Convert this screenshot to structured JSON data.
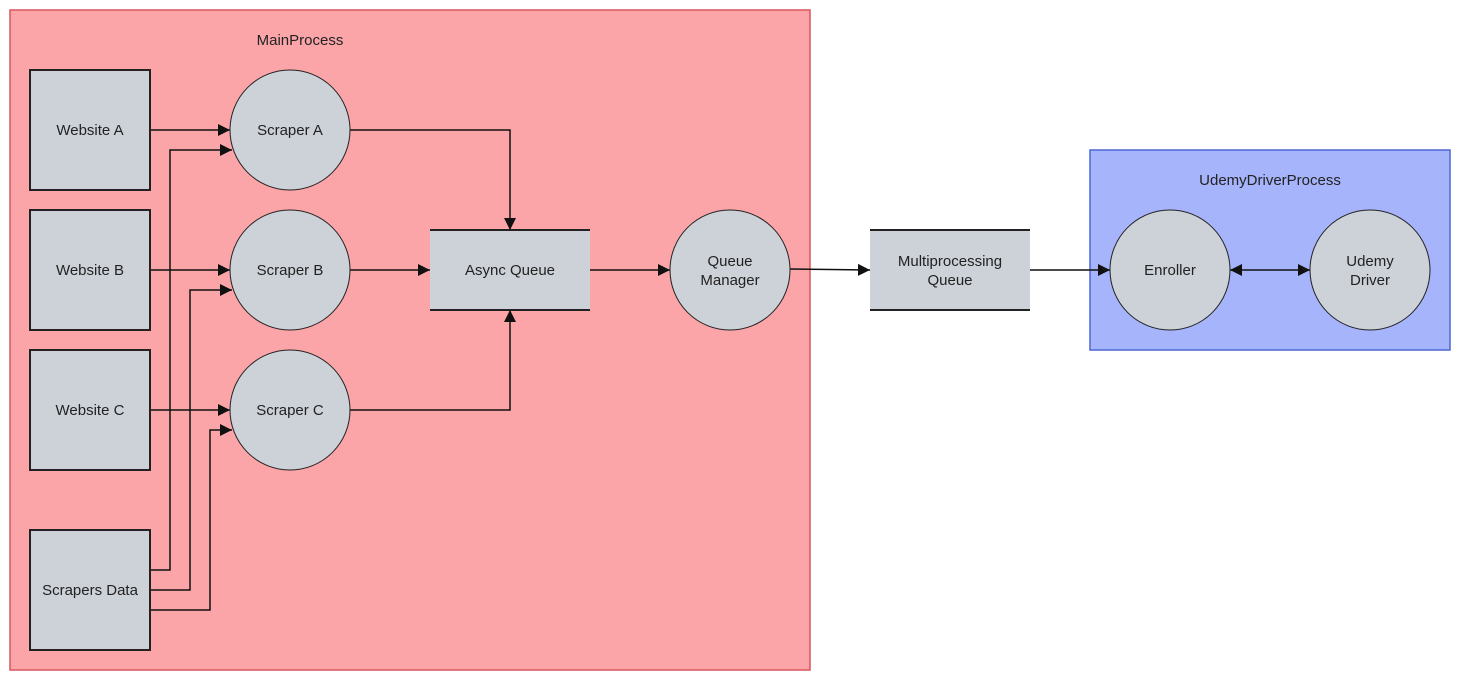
{
  "diagram": {
    "colors": {
      "main_fill": "#fba5a8",
      "main_stroke": "#d9545c",
      "udemy_fill": "#a6b4fb",
      "udemy_stroke": "#4f67d2",
      "node_fill": "#cdd2d9",
      "node_stroke": "#222222",
      "edge": "#111111"
    },
    "groups": [
      {
        "id": "main",
        "label": "MainProcess"
      },
      {
        "id": "udemy",
        "label": "UdemyDriverProcess"
      }
    ],
    "nodes": [
      {
        "id": "website_a",
        "shape": "square",
        "lines": [
          "Website A"
        ]
      },
      {
        "id": "website_b",
        "shape": "square",
        "lines": [
          "Website B"
        ]
      },
      {
        "id": "website_c",
        "shape": "square",
        "lines": [
          "Website C"
        ]
      },
      {
        "id": "scrapers_data",
        "shape": "square",
        "lines": [
          "Scrapers Data"
        ]
      },
      {
        "id": "scraper_a",
        "shape": "circle",
        "lines": [
          "Scraper A"
        ]
      },
      {
        "id": "scraper_b",
        "shape": "circle",
        "lines": [
          "Scraper B"
        ]
      },
      {
        "id": "scraper_c",
        "shape": "circle",
        "lines": [
          "Scraper C"
        ]
      },
      {
        "id": "async_queue",
        "shape": "queue",
        "lines": [
          "Async Queue"
        ]
      },
      {
        "id": "queue_manager",
        "shape": "circle",
        "lines": [
          "Queue",
          "Manager"
        ]
      },
      {
        "id": "mp_queue",
        "shape": "queue",
        "lines": [
          "Multiprocessing",
          "Queue"
        ]
      },
      {
        "id": "enroller",
        "shape": "circle",
        "lines": [
          "Enroller"
        ]
      },
      {
        "id": "udemy_driver",
        "shape": "circle",
        "lines": [
          "Udemy",
          "Driver"
        ]
      }
    ],
    "edges": [
      {
        "from": "website_a",
        "to": "scraper_a",
        "direction": "forward"
      },
      {
        "from": "website_b",
        "to": "scraper_b",
        "direction": "forward"
      },
      {
        "from": "website_c",
        "to": "scraper_c",
        "direction": "forward"
      },
      {
        "from": "scrapers_data",
        "to": "scraper_a",
        "direction": "forward"
      },
      {
        "from": "scrapers_data",
        "to": "scraper_b",
        "direction": "forward"
      },
      {
        "from": "scrapers_data",
        "to": "scraper_c",
        "direction": "forward"
      },
      {
        "from": "scraper_a",
        "to": "async_queue",
        "direction": "forward"
      },
      {
        "from": "scraper_b",
        "to": "async_queue",
        "direction": "forward"
      },
      {
        "from": "scraper_c",
        "to": "async_queue",
        "direction": "forward"
      },
      {
        "from": "async_queue",
        "to": "queue_manager",
        "direction": "forward"
      },
      {
        "from": "queue_manager",
        "to": "mp_queue",
        "direction": "forward"
      },
      {
        "from": "mp_queue",
        "to": "enroller",
        "direction": "forward"
      },
      {
        "from": "enroller",
        "to": "udemy_driver",
        "direction": "both"
      }
    ]
  }
}
